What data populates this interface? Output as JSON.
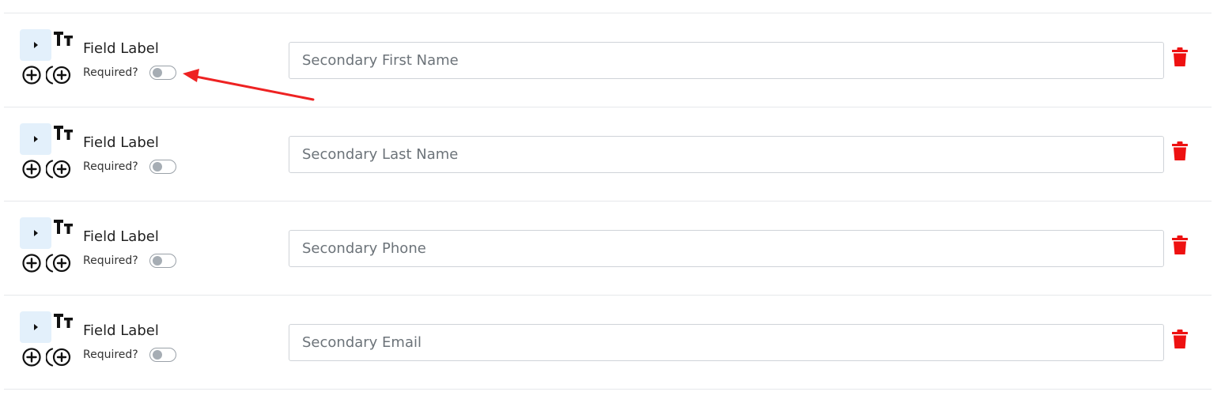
{
  "colors": {
    "delete": "#ee1111",
    "annotation_arrow": "#ee2222",
    "expand_button_bg": "#e3f0fb"
  },
  "icons": {
    "expand": "caret-right-icon",
    "text_size": "text-size-icon",
    "add": "add-circle-icon",
    "add_nested": "add-circle-ring-icon",
    "delete": "trash-icon"
  },
  "fields": [
    {
      "label": "Field Label",
      "required_label": "Required?",
      "required": false,
      "placeholder": "Secondary First Name",
      "value": ""
    },
    {
      "label": "Field Label",
      "required_label": "Required?",
      "required": false,
      "placeholder": "Secondary Last Name",
      "value": ""
    },
    {
      "label": "Field Label",
      "required_label": "Required?",
      "required": false,
      "placeholder": "Secondary Phone",
      "value": ""
    },
    {
      "label": "Field Label",
      "required_label": "Required?",
      "required": false,
      "placeholder": "Secondary Email",
      "value": ""
    }
  ]
}
